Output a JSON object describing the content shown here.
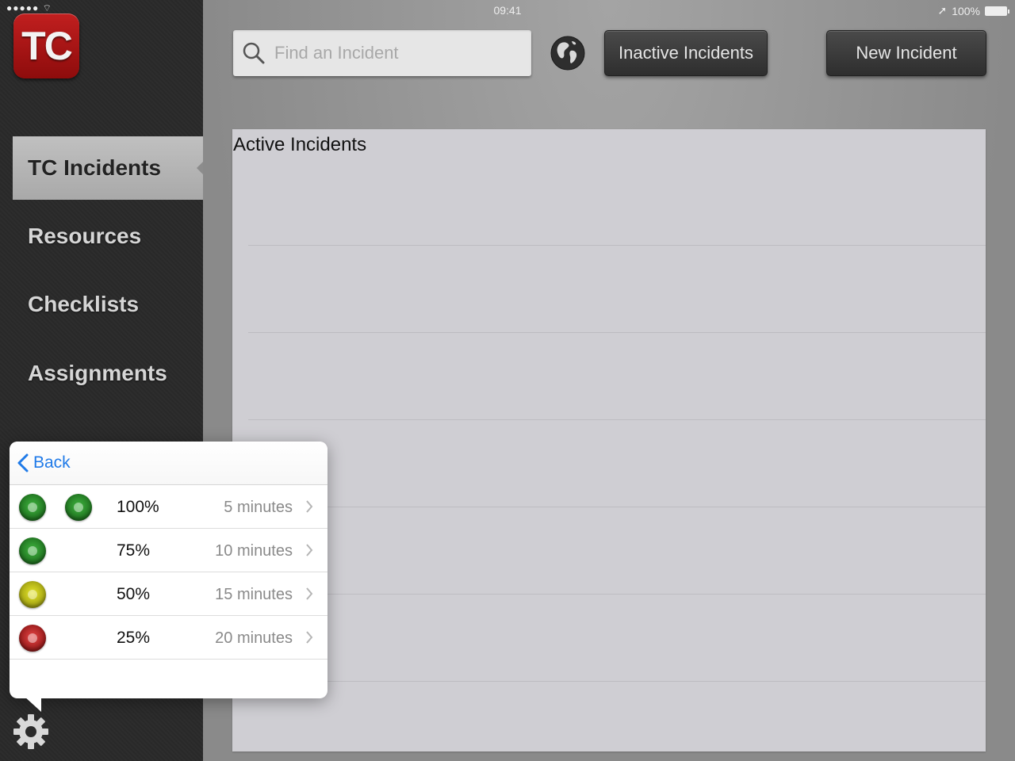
{
  "status_bar": {
    "signal": "●●●●● ",
    "time": "09:41",
    "battery": "100%"
  },
  "sidebar": {
    "logo": "TC",
    "items": [
      {
        "label": "TC Incidents",
        "active": true
      },
      {
        "label": "Resources",
        "active": false
      },
      {
        "label": "Checklists",
        "active": false
      },
      {
        "label": "Assignments",
        "active": false
      }
    ],
    "settings_icon": "gear-icon"
  },
  "toolbar": {
    "search_placeholder": "Find an Incident",
    "search_value": "",
    "globe_icon": "globe-icon",
    "inactive_label": "Inactive Incidents",
    "new_label": "New Incident"
  },
  "panel": {
    "title": "Active Incidents"
  },
  "popover": {
    "back_label": "Back",
    "rows": [
      {
        "lights": [
          "green",
          "green"
        ],
        "percent": "100%",
        "duration": "5 minutes"
      },
      {
        "lights": [
          "green"
        ],
        "percent": "75%",
        "duration": "10 minutes"
      },
      {
        "lights": [
          "yellow"
        ],
        "percent": "50%",
        "duration": "15 minutes"
      },
      {
        "lights": [
          "red"
        ],
        "percent": "25%",
        "duration": "20 minutes"
      }
    ]
  },
  "colors": {
    "accent_blue": "#1f7ae8",
    "logo_red": "#b31818",
    "green": "#2e9a2e",
    "yellow": "#d4d41c",
    "red": "#d23030"
  }
}
